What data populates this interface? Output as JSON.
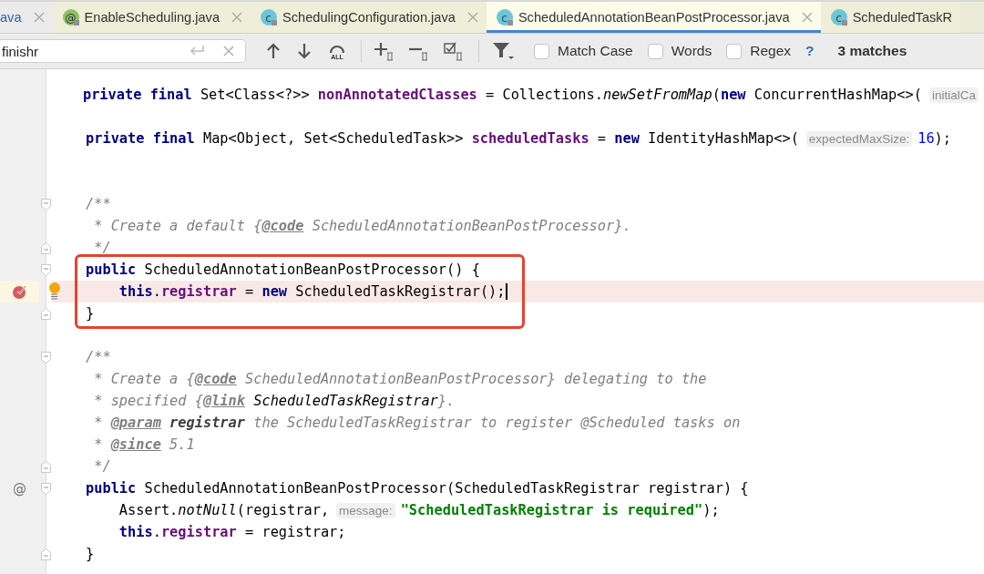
{
  "tabs": [
    {
      "label": "ava",
      "kind": "plain",
      "modified": true,
      "selected": false,
      "closable": true
    },
    {
      "label": "EnableScheduling.java",
      "kind": "annotation",
      "icon_text": "@",
      "modified": false,
      "selected": false,
      "closable": true
    },
    {
      "label": "SchedulingConfiguration.java",
      "kind": "class",
      "icon_text": "c",
      "modified": false,
      "selected": false,
      "closable": true
    },
    {
      "label": "ScheduledAnnotationBeanPostProcessor.java",
      "kind": "class",
      "icon_text": "c",
      "modified": false,
      "selected": true,
      "closable": true
    },
    {
      "label": "ScheduledTaskR",
      "kind": "class",
      "icon_text": "c",
      "modified": false,
      "selected": false,
      "closable": false
    }
  ],
  "search": {
    "value": "finishr",
    "tools": [
      {
        "kind": "prev"
      },
      {
        "kind": "next"
      },
      {
        "kind": "select-all",
        "badge": "ALL"
      },
      {
        "kind": "separator"
      },
      {
        "kind": "add-selection"
      },
      {
        "kind": "remove-selection"
      },
      {
        "kind": "toggle-selection"
      },
      {
        "kind": "separator"
      },
      {
        "kind": "filter"
      }
    ],
    "options": [
      {
        "label": "Match Case",
        "checked": false
      },
      {
        "label": "Words",
        "checked": false
      },
      {
        "label": "Regex",
        "checked": false
      }
    ],
    "help": "?",
    "result": "3 matches"
  },
  "lines": [
    {
      "highlighted": false,
      "caret": false,
      "boxed": false,
      "fold_start": false,
      "fold_end": false,
      "tokens": [
        {
          "kind": "kw",
          "text": "private final "
        },
        {
          "kind": "plain",
          "text": "Set<Class<?>> "
        },
        {
          "kind": "field",
          "text": "nonAnnotatedClasses"
        },
        {
          "kind": "plain",
          "text": " = Collections."
        },
        {
          "kind": "italic",
          "text": "newSetFromMap"
        },
        {
          "kind": "plain",
          "text": "("
        },
        {
          "kind": "kw",
          "text": "new"
        },
        {
          "kind": "plain",
          "text": " ConcurrentHashMap<>("
        },
        {
          "kind": "hint",
          "text": "initialCa"
        }
      ]
    },
    {
      "highlighted": false,
      "caret": false,
      "boxed": false,
      "fold_start": false,
      "fold_end": false
    },
    {
      "highlighted": false,
      "caret": false,
      "boxed": false,
      "fold_start": false,
      "fold_end": false,
      "tokens": [
        {
          "kind": "kw",
          "text": "private final "
        },
        {
          "kind": "plain",
          "text": "Map<Object, Set<ScheduledTask>> "
        },
        {
          "kind": "field",
          "text": "scheduledTasks"
        },
        {
          "kind": "plain",
          "text": " = "
        },
        {
          "kind": "kw",
          "text": "new"
        },
        {
          "kind": "plain",
          "text": " IdentityHashMap<>("
        },
        {
          "kind": "hint",
          "text": "expectedMaxSize:"
        },
        {
          "kind": "number",
          "text": "16"
        },
        {
          "kind": "plain",
          "text": ");"
        }
      ]
    },
    {
      "highlighted": false,
      "caret": false,
      "boxed": false,
      "fold_start": false,
      "fold_end": false
    },
    {
      "highlighted": false,
      "caret": false,
      "boxed": false,
      "fold_start": false,
      "fold_end": false
    },
    {
      "highlighted": false,
      "caret": false,
      "boxed": false,
      "fold_start": true,
      "fold_end": false,
      "tokens": [
        {
          "kind": "comment",
          "text": "/**"
        }
      ]
    },
    {
      "highlighted": false,
      "caret": false,
      "boxed": false,
      "fold_start": false,
      "fold_end": false,
      "tokens": [
        {
          "kind": "comment",
          "text": " * Create a default {"
        },
        {
          "kind": "doctag",
          "text": "@code"
        },
        {
          "kind": "comment",
          "text": " ScheduledAnnotationBeanPostProcessor}."
        }
      ]
    },
    {
      "highlighted": false,
      "caret": false,
      "boxed": false,
      "fold_start": false,
      "fold_end": true,
      "tokens": [
        {
          "kind": "comment",
          "text": " */"
        }
      ]
    },
    {
      "highlighted": false,
      "caret": false,
      "boxed": true,
      "fold_start": true,
      "fold_end": false,
      "tokens": [
        {
          "kind": "kw",
          "text": "public"
        },
        {
          "kind": "plain",
          "text": " ScheduledAnnotationBeanPostProcessor() {"
        }
      ]
    },
    {
      "highlighted": true,
      "caret": true,
      "boxed": true,
      "fold_start": false,
      "fold_end": false,
      "gutter_marks": [
        {
          "kind": "breakpoint"
        },
        {
          "kind": "intention-bulb"
        }
      ],
      "tokens": [
        {
          "kind": "kw",
          "text": "    this"
        },
        {
          "kind": "plain",
          "text": "."
        },
        {
          "kind": "field",
          "text": "registrar"
        },
        {
          "kind": "plain",
          "text": " = "
        },
        {
          "kind": "kw",
          "text": "new"
        },
        {
          "kind": "plain",
          "text": " ScheduledTaskRegistrar();"
        }
      ]
    },
    {
      "highlighted": false,
      "caret": false,
      "boxed": true,
      "fold_start": false,
      "fold_end": true,
      "tokens": [
        {
          "kind": "plain",
          "text": "}"
        }
      ]
    },
    {
      "highlighted": false,
      "caret": false,
      "boxed": false,
      "fold_start": false,
      "fold_end": false
    },
    {
      "highlighted": false,
      "caret": false,
      "boxed": false,
      "fold_start": true,
      "fold_end": false,
      "tokens": [
        {
          "kind": "comment",
          "text": "/**"
        }
      ]
    },
    {
      "highlighted": false,
      "caret": false,
      "boxed": false,
      "fold_start": false,
      "fold_end": false,
      "tokens": [
        {
          "kind": "comment",
          "text": " * Create a {"
        },
        {
          "kind": "doctag",
          "text": "@code"
        },
        {
          "kind": "comment",
          "text": " ScheduledAnnotationBeanPostProcessor} delegating to the"
        }
      ]
    },
    {
      "highlighted": false,
      "caret": false,
      "boxed": false,
      "fold_start": false,
      "fold_end": false,
      "tokens": [
        {
          "kind": "comment",
          "text": " * specified {"
        },
        {
          "kind": "doctag",
          "text": "@link"
        },
        {
          "kind": "docref",
          "text": " ScheduledTaskRegistrar"
        },
        {
          "kind": "comment",
          "text": "}."
        }
      ]
    },
    {
      "highlighted": false,
      "caret": false,
      "boxed": false,
      "fold_start": false,
      "fold_end": false,
      "tokens": [
        {
          "kind": "comment",
          "text": " * "
        },
        {
          "kind": "doctag",
          "text": "@param"
        },
        {
          "kind": "docbold",
          "text": " registrar"
        },
        {
          "kind": "comment",
          "text": " the ScheduledTaskRegistrar to register @Scheduled tasks on"
        }
      ]
    },
    {
      "highlighted": false,
      "caret": false,
      "boxed": false,
      "fold_start": false,
      "fold_end": false,
      "tokens": [
        {
          "kind": "comment",
          "text": " * "
        },
        {
          "kind": "doctag",
          "text": "@since"
        },
        {
          "kind": "comment",
          "text": " 5.1"
        }
      ]
    },
    {
      "highlighted": false,
      "caret": false,
      "boxed": false,
      "fold_start": false,
      "fold_end": true,
      "tokens": [
        {
          "kind": "comment",
          "text": " */"
        }
      ]
    },
    {
      "highlighted": false,
      "caret": false,
      "boxed": false,
      "fold_start": true,
      "fold_end": false,
      "gutter_text": "@",
      "tokens": [
        {
          "kind": "kw",
          "text": "public"
        },
        {
          "kind": "plain",
          "text": " ScheduledAnnotationBeanPostProcessor(ScheduledTaskRegistrar registrar) {"
        }
      ]
    },
    {
      "highlighted": false,
      "caret": false,
      "boxed": false,
      "fold_start": false,
      "fold_end": false,
      "tokens": [
        {
          "kind": "plain",
          "text": "    Assert."
        },
        {
          "kind": "italic",
          "text": "notNull"
        },
        {
          "kind": "plain",
          "text": "(registrar,"
        },
        {
          "kind": "hint",
          "text": "message:"
        },
        {
          "kind": "string",
          "text": "\"ScheduledTaskRegistrar is required\""
        },
        {
          "kind": "plain",
          "text": ");"
        }
      ]
    },
    {
      "highlighted": false,
      "caret": false,
      "boxed": false,
      "fold_start": false,
      "fold_end": false,
      "tokens": [
        {
          "kind": "kw",
          "text": "    this"
        },
        {
          "kind": "plain",
          "text": "."
        },
        {
          "kind": "field",
          "text": "registrar"
        },
        {
          "kind": "plain",
          "text": " = registrar;"
        }
      ]
    },
    {
      "highlighted": false,
      "caret": false,
      "boxed": false,
      "fold_start": false,
      "fold_end": true,
      "tokens": [
        {
          "kind": "plain",
          "text": "}"
        }
      ]
    }
  ]
}
